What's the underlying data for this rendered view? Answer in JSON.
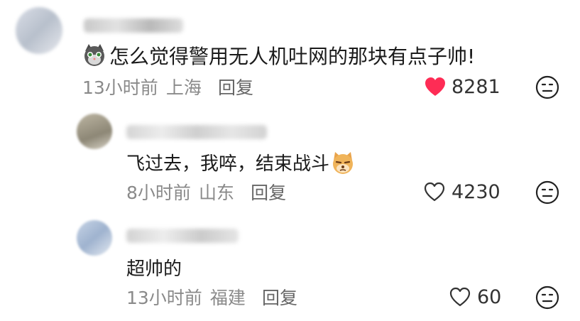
{
  "comments": [
    {
      "text": "怎么觉得警用无人机吐网的那块有点子帅!",
      "time": "13小时前",
      "location": "上海",
      "reply_label": "回复",
      "likes": "8281",
      "liked": true
    },
    {
      "text": "飞过去，我啐，结束战斗",
      "time": "8小时前",
      "location": "山东",
      "reply_label": "回复",
      "likes": "4230",
      "liked": false
    },
    {
      "text": "超帅的",
      "time": "13小时前",
      "location": "福建",
      "reply_label": "回复",
      "likes": "60",
      "liked": false
    }
  ],
  "colors": {
    "like_active": "#fe2c55",
    "meta": "#8a8a8a"
  },
  "icons": [
    "cat-emoji-icon",
    "heart-icon",
    "dislike-face-icon",
    "dog-emoji-icon"
  ]
}
